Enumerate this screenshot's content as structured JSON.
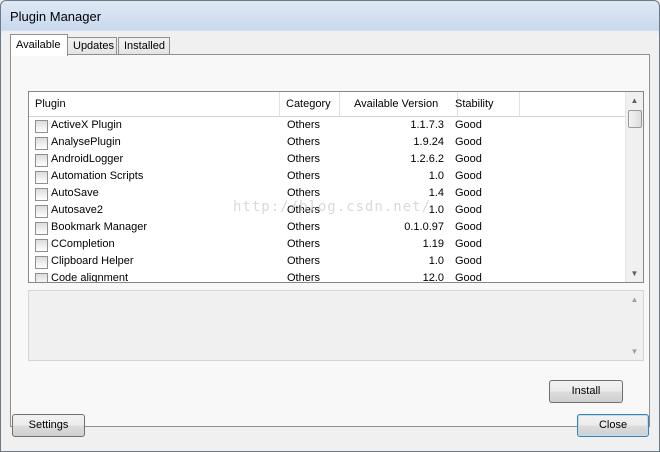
{
  "window": {
    "title": "Plugin Manager"
  },
  "tabs": [
    {
      "label": "Available",
      "active": true
    },
    {
      "label": "Updates",
      "active": false
    },
    {
      "label": "Installed",
      "active": false
    }
  ],
  "list": {
    "columns": [
      "Plugin",
      "Category",
      "Available Version",
      "Stability"
    ],
    "rows": [
      {
        "name": "ActiveX Plugin",
        "category": "Others",
        "version": "1.1.7.3",
        "stability": "Good"
      },
      {
        "name": "AnalysePlugin",
        "category": "Others",
        "version": "1.9.24",
        "stability": "Good"
      },
      {
        "name": "AndroidLogger",
        "category": "Others",
        "version": "1.2.6.2",
        "stability": "Good"
      },
      {
        "name": "Automation Scripts",
        "category": "Others",
        "version": "1.0",
        "stability": "Good"
      },
      {
        "name": "AutoSave",
        "category": "Others",
        "version": "1.4",
        "stability": "Good"
      },
      {
        "name": "Autosave2",
        "category": "Others",
        "version": "1.0",
        "stability": "Good"
      },
      {
        "name": "Bookmark Manager",
        "category": "Others",
        "version": "0.1.0.97",
        "stability": "Good"
      },
      {
        "name": "CCompletion",
        "category": "Others",
        "version": "1.19",
        "stability": "Good"
      },
      {
        "name": "Clipboard Helper",
        "category": "Others",
        "version": "1.0",
        "stability": "Good"
      },
      {
        "name": "Code alignment",
        "category": "Others",
        "version": "12.0",
        "stability": "Good"
      }
    ]
  },
  "watermark": "http://blog.csdn.net/",
  "buttons": {
    "install": "Install",
    "settings": "Settings",
    "close": "Close"
  },
  "icons": {
    "scroll_up": "up-arrow-icon",
    "scroll_down": "down-arrow-icon"
  }
}
